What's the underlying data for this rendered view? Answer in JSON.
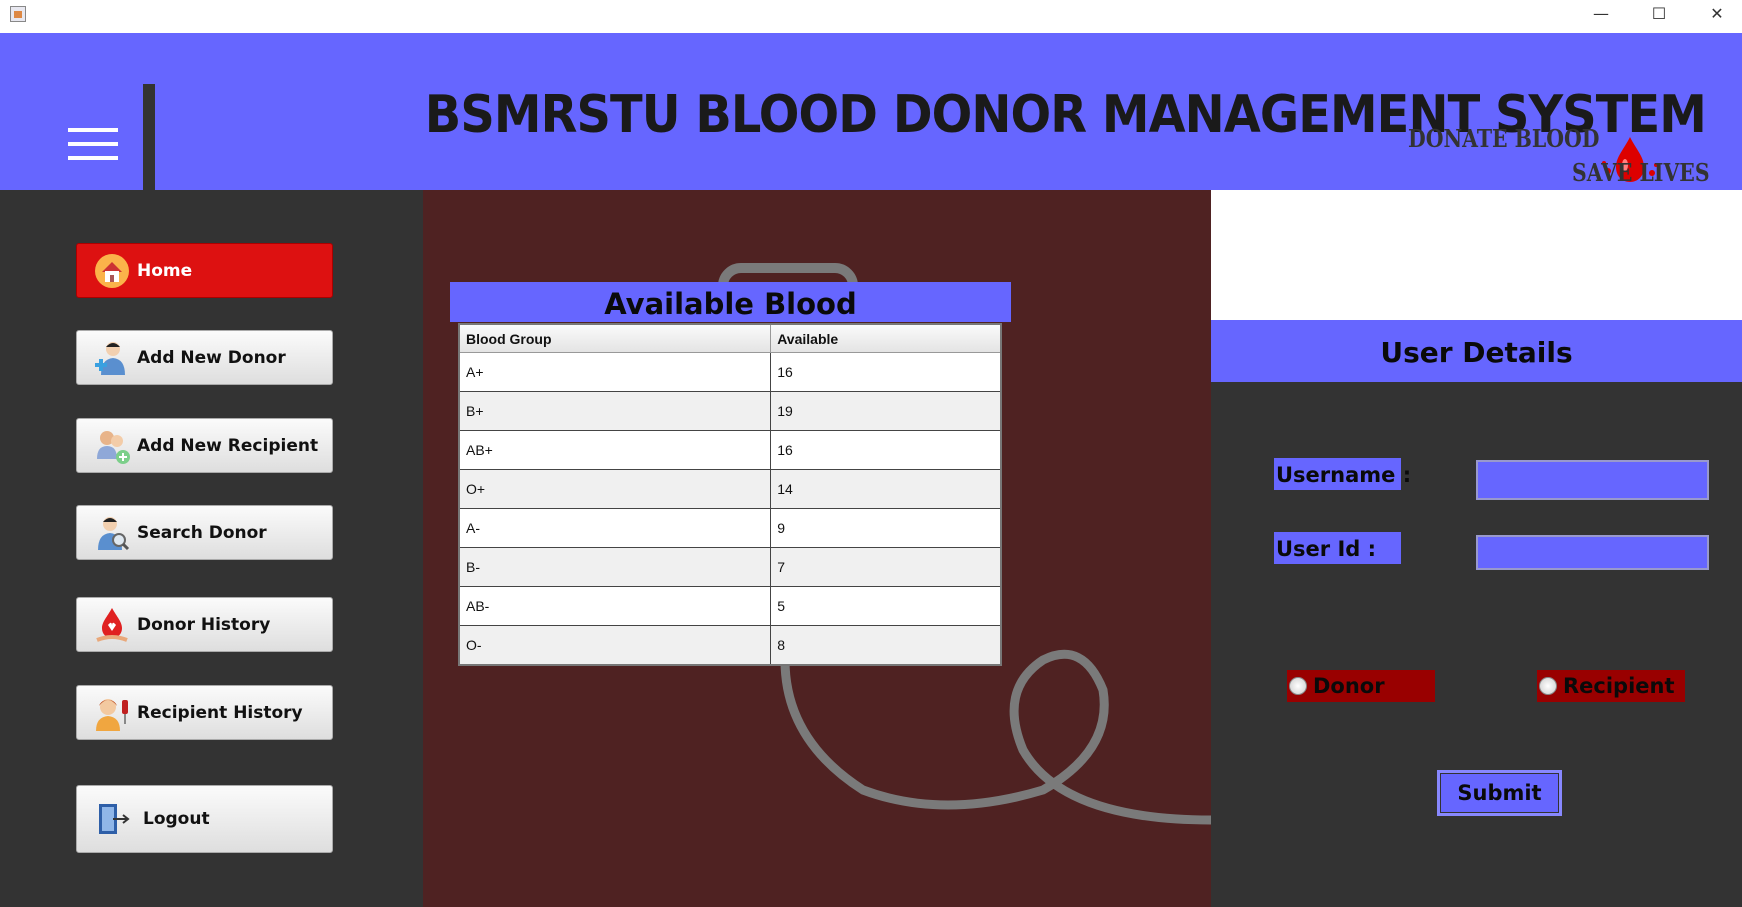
{
  "window": {
    "controls": {
      "minimize": "—",
      "maximize": "☐",
      "close": "✕"
    }
  },
  "header": {
    "title": "BSMRSTU BLOOD DONOR MANAGEMENT SYSTEM",
    "tagline_top": "DONATE BLOOD",
    "tagline_bottom": "SAVE LIVES"
  },
  "sidebar": {
    "items": [
      {
        "label": "Home",
        "icon": "home-icon",
        "active": true
      },
      {
        "label": "Add New Donor",
        "icon": "add-donor-icon",
        "active": false
      },
      {
        "label": "Add New Recipient",
        "icon": "add-recipient-icon",
        "active": false
      },
      {
        "label": "Search Donor",
        "icon": "search-donor-icon",
        "active": false
      },
      {
        "label": "Donor History",
        "icon": "donor-history-icon",
        "active": false
      },
      {
        "label": "Recipient History",
        "icon": "recipient-history-icon",
        "active": false
      },
      {
        "label": "Logout",
        "icon": "logout-icon",
        "active": false
      }
    ]
  },
  "available_blood": {
    "title": "Available Blood",
    "columns": [
      "Blood Group",
      "Available"
    ],
    "rows": [
      [
        "A+",
        "16"
      ],
      [
        "B+",
        "19"
      ],
      [
        "AB+",
        "16"
      ],
      [
        "O+",
        "14"
      ],
      [
        "A-",
        "9"
      ],
      [
        "B-",
        "7"
      ],
      [
        "AB-",
        "5"
      ],
      [
        "O-",
        "8"
      ]
    ]
  },
  "user_details": {
    "title": "User Details",
    "username_label": "Username :",
    "username_value": "",
    "userid_label": "User Id :",
    "userid_value": "",
    "role_donor": "Donor",
    "role_recipient": "Recipient",
    "submit_label": "Submit"
  },
  "colors": {
    "header_bg": "#6666ff",
    "sidebar_bg": "#333333",
    "main_bg": "#4f2222",
    "active_button": "#dd1111",
    "radio_bg": "#990000"
  }
}
